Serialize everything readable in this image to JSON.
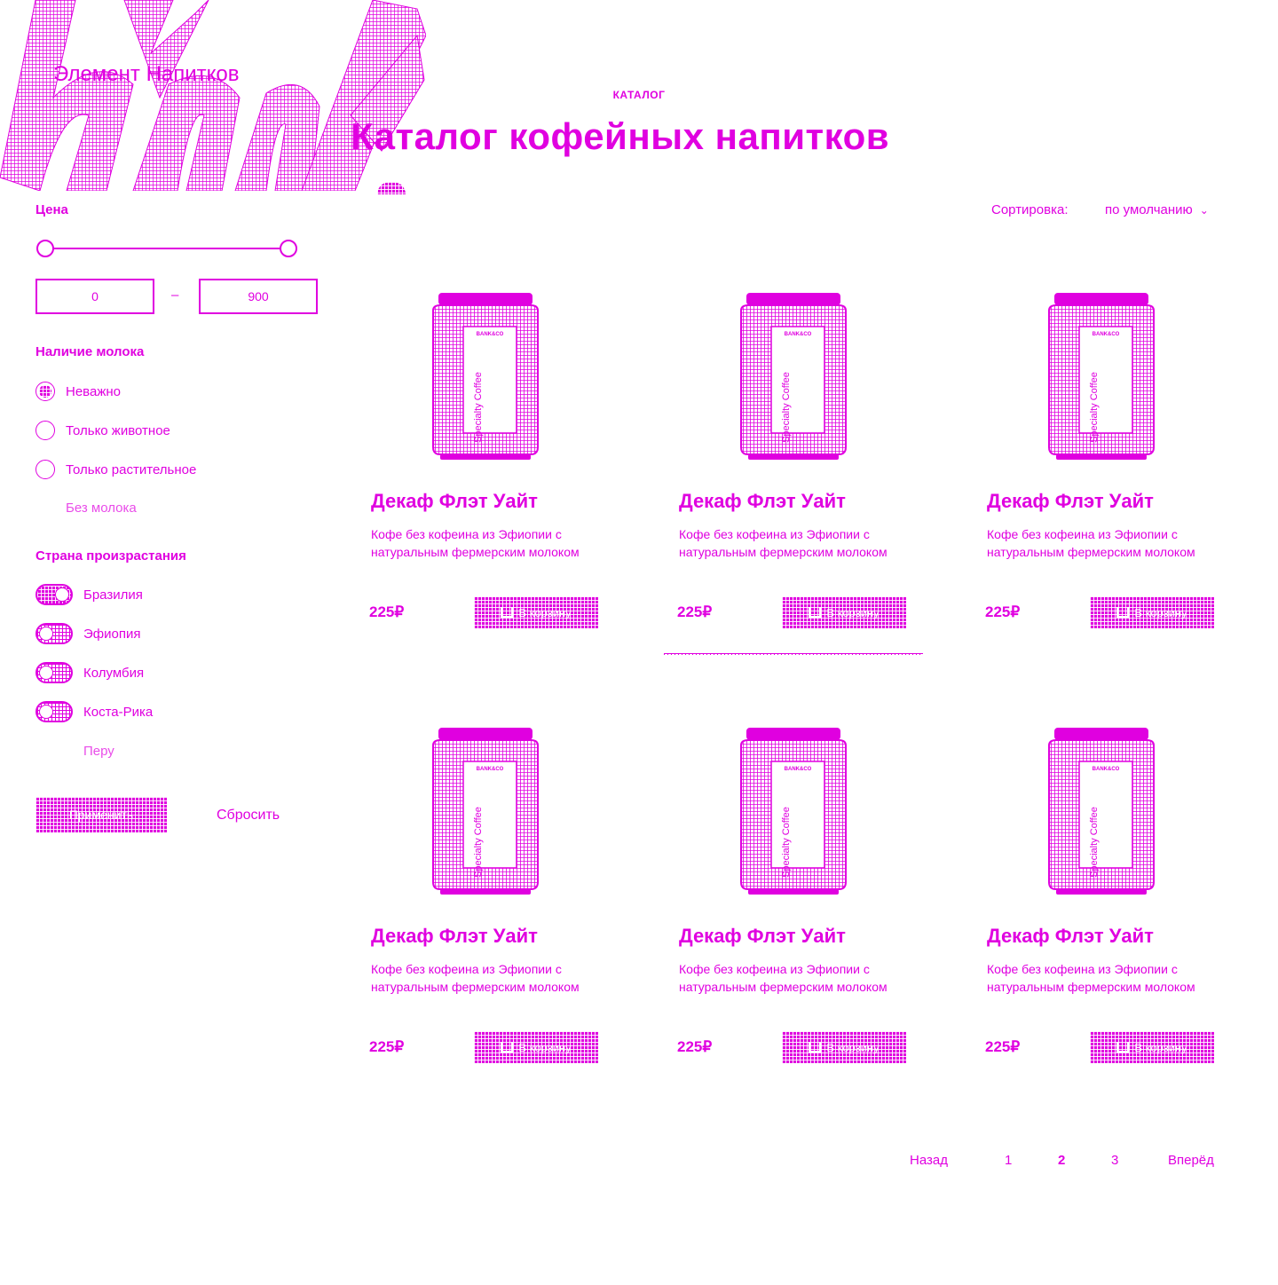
{
  "brand": {
    "name": "Элемент Напитков"
  },
  "breadcrumb": "КАТАЛОГ",
  "title": "Каталог кофейных напитков",
  "sort": {
    "label": "Сортировка:",
    "value": "по умолчанию"
  },
  "filters": {
    "price": {
      "label": "Цена",
      "min_value": "0",
      "max_value": "900",
      "separator": "–"
    },
    "milk": {
      "label": "Наличие молока",
      "options": [
        {
          "label": "Неважно",
          "selected": true
        },
        {
          "label": "Только животное",
          "selected": false
        },
        {
          "label": "Только растительное",
          "selected": false
        }
      ],
      "more": "Без молока"
    },
    "country": {
      "label": "Страна произрастания",
      "options": [
        {
          "label": "Бразилия",
          "on": true
        },
        {
          "label": "Эфиопия",
          "on": false
        },
        {
          "label": "Колумбия",
          "on": false
        },
        {
          "label": "Коста-Рика",
          "on": false
        }
      ],
      "more": "Перу"
    },
    "apply_label": "Применить",
    "reset_label": "Сбросить"
  },
  "products": [
    {
      "title": "Декаф Флэт Уайт",
      "desc": "Кофе без кофеина из Эфиопии с натуральным фермерским молоком",
      "price": "225₽",
      "button": "В корзину",
      "can_brand": "BANK&CO",
      "can_text": "Specialty Coffee"
    },
    {
      "title": "Декаф Флэт Уайт",
      "desc": "Кофе без кофеина из Эфиопии с натуральным фермерским молоком",
      "price": "225₽",
      "button": "В корзину",
      "can_brand": "BANK&CO",
      "can_text": "Specialty Coffee"
    },
    {
      "title": "Декаф Флэт Уайт",
      "desc": "Кофе без кофеина из Эфиопии с натуральным фермерским молоком",
      "price": "225₽",
      "button": "В корзину",
      "can_brand": "BANK&CO",
      "can_text": "Specialty Coffee"
    },
    {
      "title": "Декаф Флэт Уайт",
      "desc": "Кофе без кофеина из Эфиопии с натуральным фермерским молоком",
      "price": "225₽",
      "button": "В корзину",
      "can_brand": "BANK&CO",
      "can_text": "Specialty Coffee"
    },
    {
      "title": "Декаф Флэт Уайт",
      "desc": "Кофе без кофеина из Эфиопии с натуральным фермерским молоком",
      "price": "225₽",
      "button": "В корзину",
      "can_brand": "BANK&CO",
      "can_text": "Specialty Coffee"
    },
    {
      "title": "Декаф Флэт Уайт",
      "desc": "Кофе без кофеина из Эфиопии с натуральным фермерским молоком",
      "price": "225₽",
      "button": "В корзину",
      "can_brand": "BANK&CO",
      "can_text": "Specialty Coffee"
    }
  ],
  "pagination": {
    "prev": "Назад",
    "pages": [
      "1",
      "2",
      "3"
    ],
    "current": "2",
    "next": "Вперёд"
  },
  "colors": {
    "accent": "#e000e0",
    "background": "#ffffff"
  }
}
